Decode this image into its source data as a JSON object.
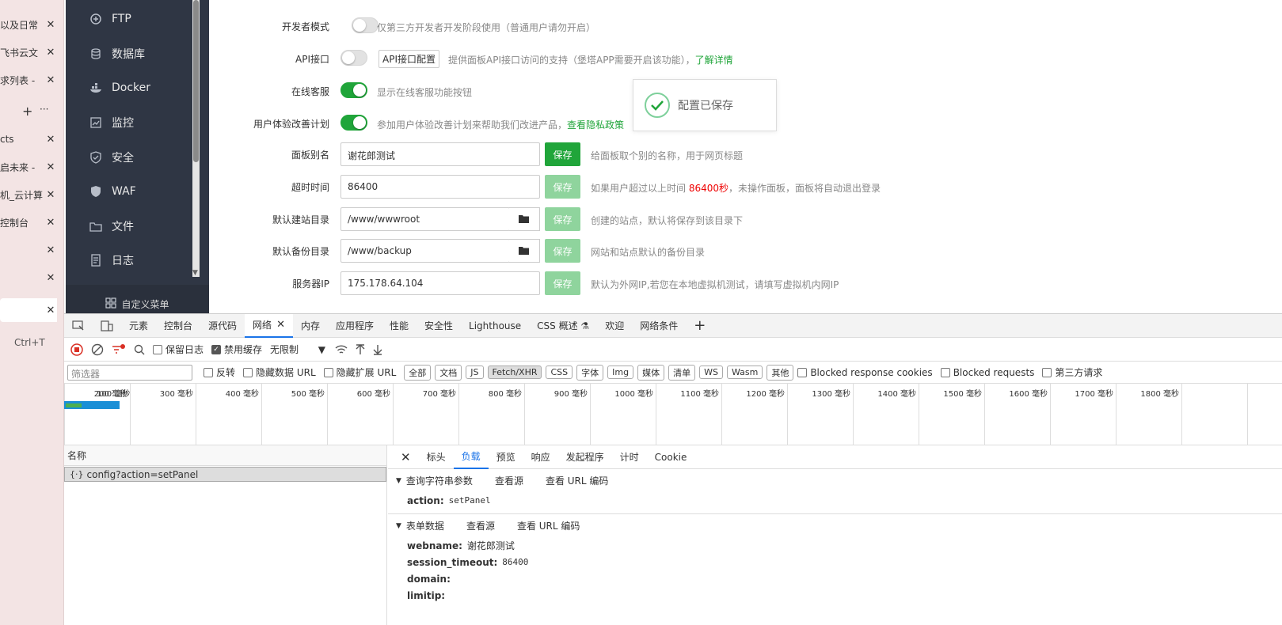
{
  "browser_tabs": [
    {
      "title": "以及日常",
      "close": "✕"
    },
    {
      "title": "飞书云文",
      "close": "✕"
    },
    {
      "title": "求列表 -",
      "close": "✕"
    },
    {
      "title": "cts",
      "close": "✕"
    },
    {
      "title": "启未来 -",
      "close": "✕"
    },
    {
      "title": "机_云计算",
      "close": "✕"
    },
    {
      "title": "控制台",
      "close": "✕"
    },
    {
      "title": "",
      "close": "✕"
    },
    {
      "title": "",
      "close": "✕"
    },
    {
      "title": "",
      "close": "✕"
    }
  ],
  "tab_add": "+",
  "tab_more": "···",
  "shortcut_hint": "Ctrl+T",
  "sidebar": {
    "items": [
      {
        "label": "FTP",
        "icon": "ftp-icon"
      },
      {
        "label": "数据库",
        "icon": "database-icon"
      },
      {
        "label": "Docker",
        "icon": "docker-icon"
      },
      {
        "label": "监控",
        "icon": "monitor-icon"
      },
      {
        "label": "安全",
        "icon": "shield-icon"
      },
      {
        "label": "WAF",
        "icon": "waf-icon"
      },
      {
        "label": "文件",
        "icon": "folder-icon"
      },
      {
        "label": "日志",
        "icon": "log-icon"
      }
    ],
    "custom_menu": "自定义菜单"
  },
  "settings": {
    "dev_mode": {
      "label": "开发者模式",
      "desc": "仅第三方开发者开发阶段使用（普通用户请勿开启）",
      "on": false
    },
    "api": {
      "label": "API接口",
      "button": "API接口配置",
      "desc": "提供面板API接口访问的支持（堡塔APP需要开启该功能），",
      "link": "了解详情",
      "on": false
    },
    "online_service": {
      "label": "在线客服",
      "desc": "显示在线客服功能按钮",
      "on": true
    },
    "ux_plan": {
      "label": "用户体验改善计划",
      "desc": "参加用户体验改善计划来帮助我们改进产品，",
      "link": "查看隐私政策",
      "on": true
    },
    "panel_alias": {
      "label": "面板别名",
      "value": "谢花郎测试",
      "save": "保存",
      "desc": "给面板取个别的名称，用于网页标题"
    },
    "timeout": {
      "label": "超时时间",
      "value": "86400",
      "save": "保存",
      "desc_pre": "如果用户超过以上时间 ",
      "desc_red": "86400秒",
      "desc_post": "，未操作面板，面板将自动退出登录"
    },
    "site_dir": {
      "label": "默认建站目录",
      "value": "/www/wwwroot",
      "save": "保存",
      "desc": "创建的站点，默认将保存到该目录下"
    },
    "backup_dir": {
      "label": "默认备份目录",
      "value": "/www/backup",
      "save": "保存",
      "desc": "网站和站点默认的备份目录"
    },
    "server_ip": {
      "label": "服务器IP",
      "value": "175.178.64.104",
      "save": "保存",
      "desc": "默认为外网IP,若您在本地虚拟机测试，请填写虚拟机内网IP"
    }
  },
  "toast": {
    "message": "配置已保存"
  },
  "devtools": {
    "tabs": [
      "元素",
      "控制台",
      "源代码",
      "网络",
      "内存",
      "应用程序",
      "性能",
      "安全性",
      "Lighthouse",
      "CSS 概述 ⚗",
      "欢迎",
      "网络条件"
    ],
    "active_tab": "网络",
    "add_tab": "+",
    "toolbar": {
      "preserve_log": "保留日志",
      "disable_cache": "禁用缓存",
      "throttle": "无限制"
    },
    "filter": {
      "placeholder": "筛选器",
      "invert": "反转",
      "hide_data_url": "隐藏数据 URL",
      "hide_ext_url": "隐藏扩展 URL",
      "types": [
        "全部",
        "文档",
        "JS",
        "Fetch/XHR",
        "CSS",
        "字体",
        "Img",
        "媒体",
        "清单",
        "WS",
        "Wasm",
        "其他"
      ],
      "active_type": "Fetch/XHR",
      "blocked_cookies": "Blocked response cookies",
      "blocked_requests": "Blocked requests",
      "third_party": "第三方请求"
    },
    "timeline_ticks": [
      "100 毫秒",
      "200 毫秒",
      "300 毫秒",
      "400 毫秒",
      "500 毫秒",
      "600 毫秒",
      "700 毫秒",
      "800 毫秒",
      "900 毫秒",
      "1000 毫秒",
      "1100 毫秒",
      "1200 毫秒",
      "1300 毫秒",
      "1400 毫秒",
      "1500 毫秒",
      "1600 毫秒",
      "1700 毫秒",
      "1800 毫秒"
    ],
    "request_list": {
      "header": "名称",
      "row": "config?action=setPanel"
    },
    "detail_tabs": [
      "标头",
      "负载",
      "预览",
      "响应",
      "发起程序",
      "计时",
      "Cookie"
    ],
    "active_detail_tab": "负载",
    "query_section": {
      "title": "查询字符串参数",
      "view_source": "查看源",
      "view_url": "查看 URL 编码",
      "params": [
        {
          "k": "action:",
          "v": "setPanel"
        }
      ]
    },
    "form_section": {
      "title": "表单数据",
      "view_source": "查看源",
      "view_url": "查看 URL 编码",
      "params": [
        {
          "k": "webname:",
          "v": "谢花郎测试"
        },
        {
          "k": "session_timeout:",
          "v": "86400"
        },
        {
          "k": "domain:",
          "v": ""
        },
        {
          "k": "limitip:",
          "v": ""
        }
      ]
    }
  }
}
